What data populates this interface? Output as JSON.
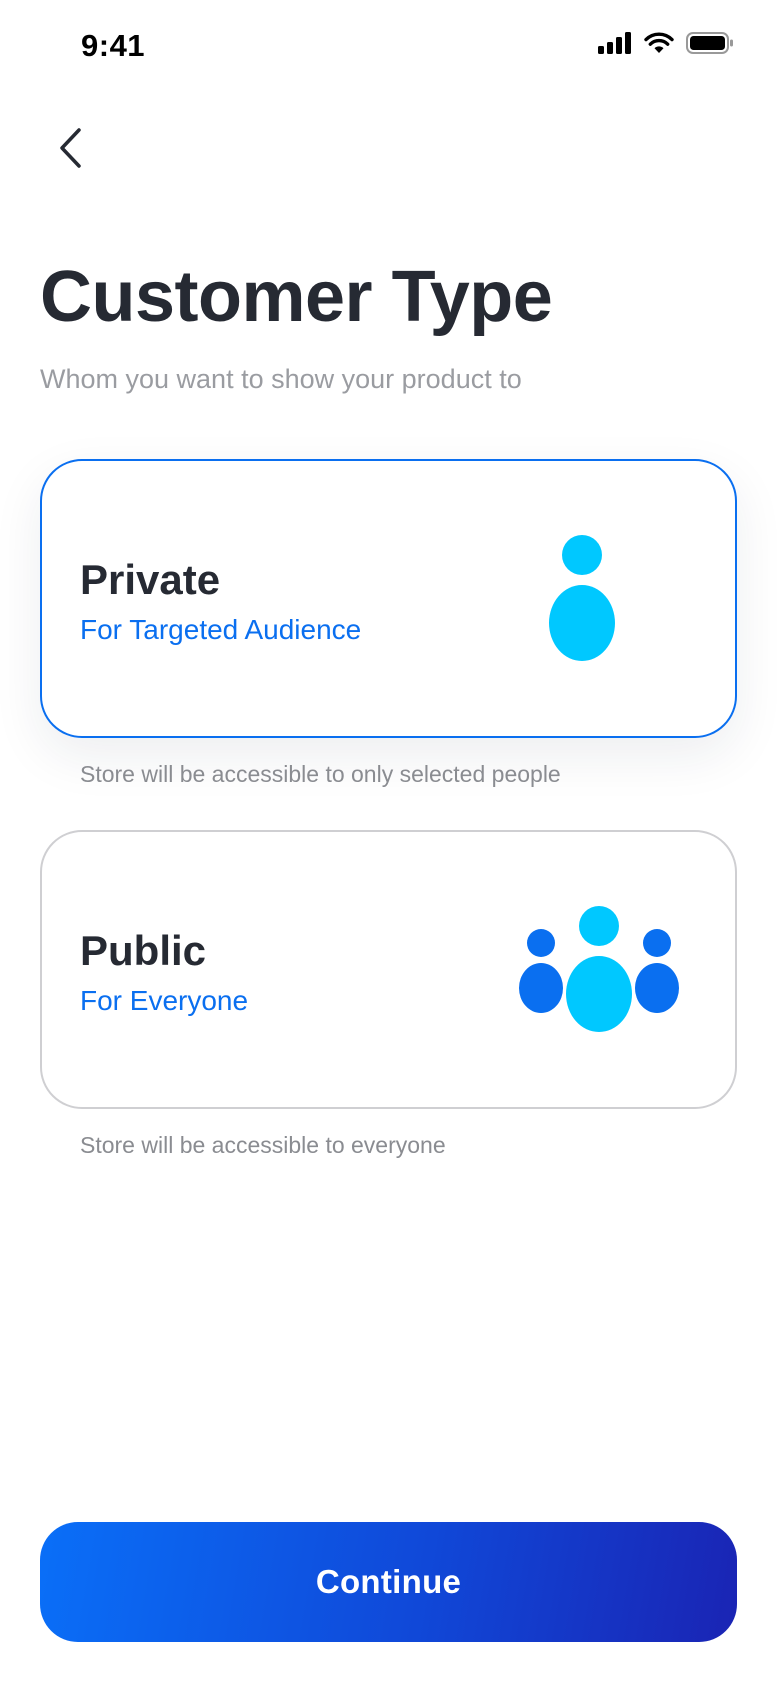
{
  "status_bar": {
    "time": "9:41"
  },
  "header": {
    "title": "Customer Type",
    "subtitle": "Whom you want to show your product to"
  },
  "options": [
    {
      "title": "Private",
      "subtitle": "For Targeted Audience",
      "caption": "Store will be accessible to only selected people",
      "icon": "single-person-icon",
      "selected": true
    },
    {
      "title": "Public",
      "subtitle": "For Everyone",
      "caption": "Store will be accessible to everyone",
      "icon": "group-people-icon",
      "selected": false
    }
  ],
  "footer": {
    "continue_label": "Continue"
  },
  "colors": {
    "accent": "#0A6FF0",
    "icon_light": "#00C8FF",
    "icon_dark": "#0A6FF0",
    "button_gradient_start": "#0A6FF8",
    "button_gradient_end": "#1A24B4"
  }
}
